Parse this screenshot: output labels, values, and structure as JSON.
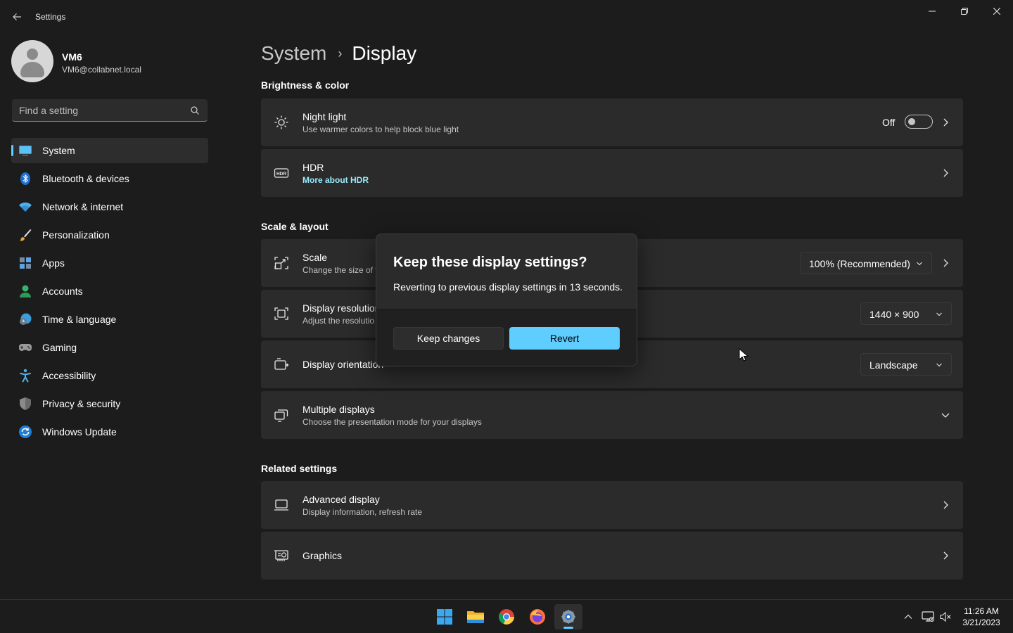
{
  "window": {
    "title": "Settings",
    "controls": [
      "minimize",
      "maximize",
      "close"
    ]
  },
  "profile": {
    "name": "VM6",
    "email": "VM6@collabnet.local"
  },
  "search": {
    "placeholder": "Find a setting"
  },
  "sidebar": {
    "items": [
      {
        "label": "System",
        "icon": "system-icon",
        "active": true
      },
      {
        "label": "Bluetooth & devices",
        "icon": "bluetooth-icon"
      },
      {
        "label": "Network & internet",
        "icon": "wifi-icon"
      },
      {
        "label": "Personalization",
        "icon": "brush-icon"
      },
      {
        "label": "Apps",
        "icon": "apps-icon"
      },
      {
        "label": "Accounts",
        "icon": "account-icon"
      },
      {
        "label": "Time & language",
        "icon": "clock-globe-icon"
      },
      {
        "label": "Gaming",
        "icon": "gamepad-icon"
      },
      {
        "label": "Accessibility",
        "icon": "accessibility-icon"
      },
      {
        "label": "Privacy & security",
        "icon": "shield-icon"
      },
      {
        "label": "Windows Update",
        "icon": "update-icon"
      }
    ]
  },
  "breadcrumb": {
    "parent": "System",
    "separator": "›",
    "current": "Display"
  },
  "sections": {
    "brightness": {
      "title": "Brightness & color",
      "night_light": {
        "title": "Night light",
        "subtitle": "Use warmer colors to help block blue light",
        "toggle_state": "Off"
      },
      "hdr": {
        "title": "HDR",
        "link": "More about HDR"
      }
    },
    "scale_layout": {
      "title": "Scale & layout",
      "scale": {
        "title": "Scale",
        "subtitle": "Change the size of t",
        "value": "100% (Recommended)"
      },
      "resolution": {
        "title": "Display resolution",
        "subtitle": "Adjust the resolutio",
        "value": "1440 × 900"
      },
      "orientation": {
        "title": "Display orientation",
        "value": "Landscape"
      },
      "multiple": {
        "title": "Multiple displays",
        "subtitle": "Choose the presentation mode for your displays"
      }
    },
    "related": {
      "title": "Related settings",
      "advanced": {
        "title": "Advanced display",
        "subtitle": "Display information, refresh rate"
      },
      "graphics": {
        "title": "Graphics"
      }
    }
  },
  "dialog": {
    "title": "Keep these display settings?",
    "message": "Reverting to previous display settings in 13 seconds.",
    "keep_label": "Keep changes",
    "revert_label": "Revert"
  },
  "taskbar": {
    "apps": [
      "start-icon",
      "file-explorer-icon",
      "chrome-icon",
      "firefox-icon",
      "settings-icon"
    ],
    "active_app": "settings-icon",
    "time": "11:26 AM",
    "date": "3/21/2023"
  },
  "colors": {
    "accent": "#60cdff",
    "background": "#1c1c1c",
    "card": "#2b2b2b",
    "link": "#99ebff"
  }
}
